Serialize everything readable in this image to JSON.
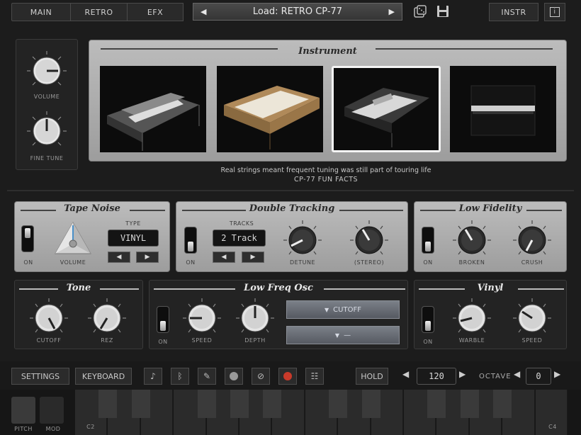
{
  "header": {
    "tabs": [
      {
        "label": "MAIN"
      },
      {
        "label": "RETRO"
      },
      {
        "label": "EFX"
      }
    ],
    "load_label": "Load: RETRO CP-77",
    "prev_icon": "triangle-left-icon",
    "next_icon": "triangle-right-icon",
    "random_icon": "dice-icon",
    "save_icon": "floppy-disk-icon",
    "instr_label": "INSTR",
    "info_label": "i"
  },
  "left_controls": {
    "volume_label": "VOLUME",
    "fine_tune_label": "FINE TUNE"
  },
  "instrument": {
    "title": "Instrument",
    "selected_index": 2,
    "thumbnails": [
      "electric-piano-black",
      "electric-piano-tan",
      "electric-grand-piano",
      "upright-piano"
    ]
  },
  "fact": {
    "text": "Real strings meant frequent tuning was still part of touring life",
    "caption": "CP-77 FUN FACTS"
  },
  "tape_noise": {
    "title": "Tape Noise",
    "on_label": "ON",
    "volume_label": "VOLUME",
    "type_label": "TYPE",
    "type_value": "VINYL"
  },
  "double_tracking": {
    "title": "Double Tracking",
    "on_label": "ON",
    "tracks_label": "TRACKS",
    "tracks_value": "2 Track",
    "detune_label": "DETUNE",
    "stereo_label": "(STEREO)"
  },
  "low_fidelity": {
    "title": "Low Fidelity",
    "on_label": "ON",
    "broken_label": "BROKEN",
    "crush_label": "CRUSH"
  },
  "tone": {
    "title": "Tone",
    "cutoff_label": "CUTOFF",
    "rez_label": "REZ"
  },
  "lfo": {
    "title": "Low Freq Osc",
    "on_label": "ON",
    "speed_label": "SPEED",
    "depth_label": "DEPTH",
    "target_value": "CUTOFF",
    "shape_value": "—"
  },
  "vinyl": {
    "title": "Vinyl",
    "on_label": "ON",
    "warble_label": "WARBLE",
    "speed_label": "SPEED"
  },
  "bottom_bar": {
    "settings_label": "SETTINGS",
    "keyboard_label": "KEYBOARD",
    "hold_label": "HOLD",
    "tempo_value": "120",
    "octave_label": "OCTAVE",
    "octave_value": "0",
    "icons": [
      "metronome-icon",
      "bluetooth-icon",
      "pencil-icon",
      "circle-icon",
      "stop-icon",
      "record-icon",
      "keyboard-icon"
    ]
  },
  "keyboard": {
    "pitch_label": "PITCH",
    "mod_label": "MOD",
    "c2_label": "C2",
    "c4_label": "C4"
  },
  "colors": {
    "background": "#1c1c1c",
    "panel_light": "#b0b0b0",
    "panel_dark": "#232323",
    "record_red": "#c83a2a",
    "selected_border": "#f4f4f4"
  }
}
